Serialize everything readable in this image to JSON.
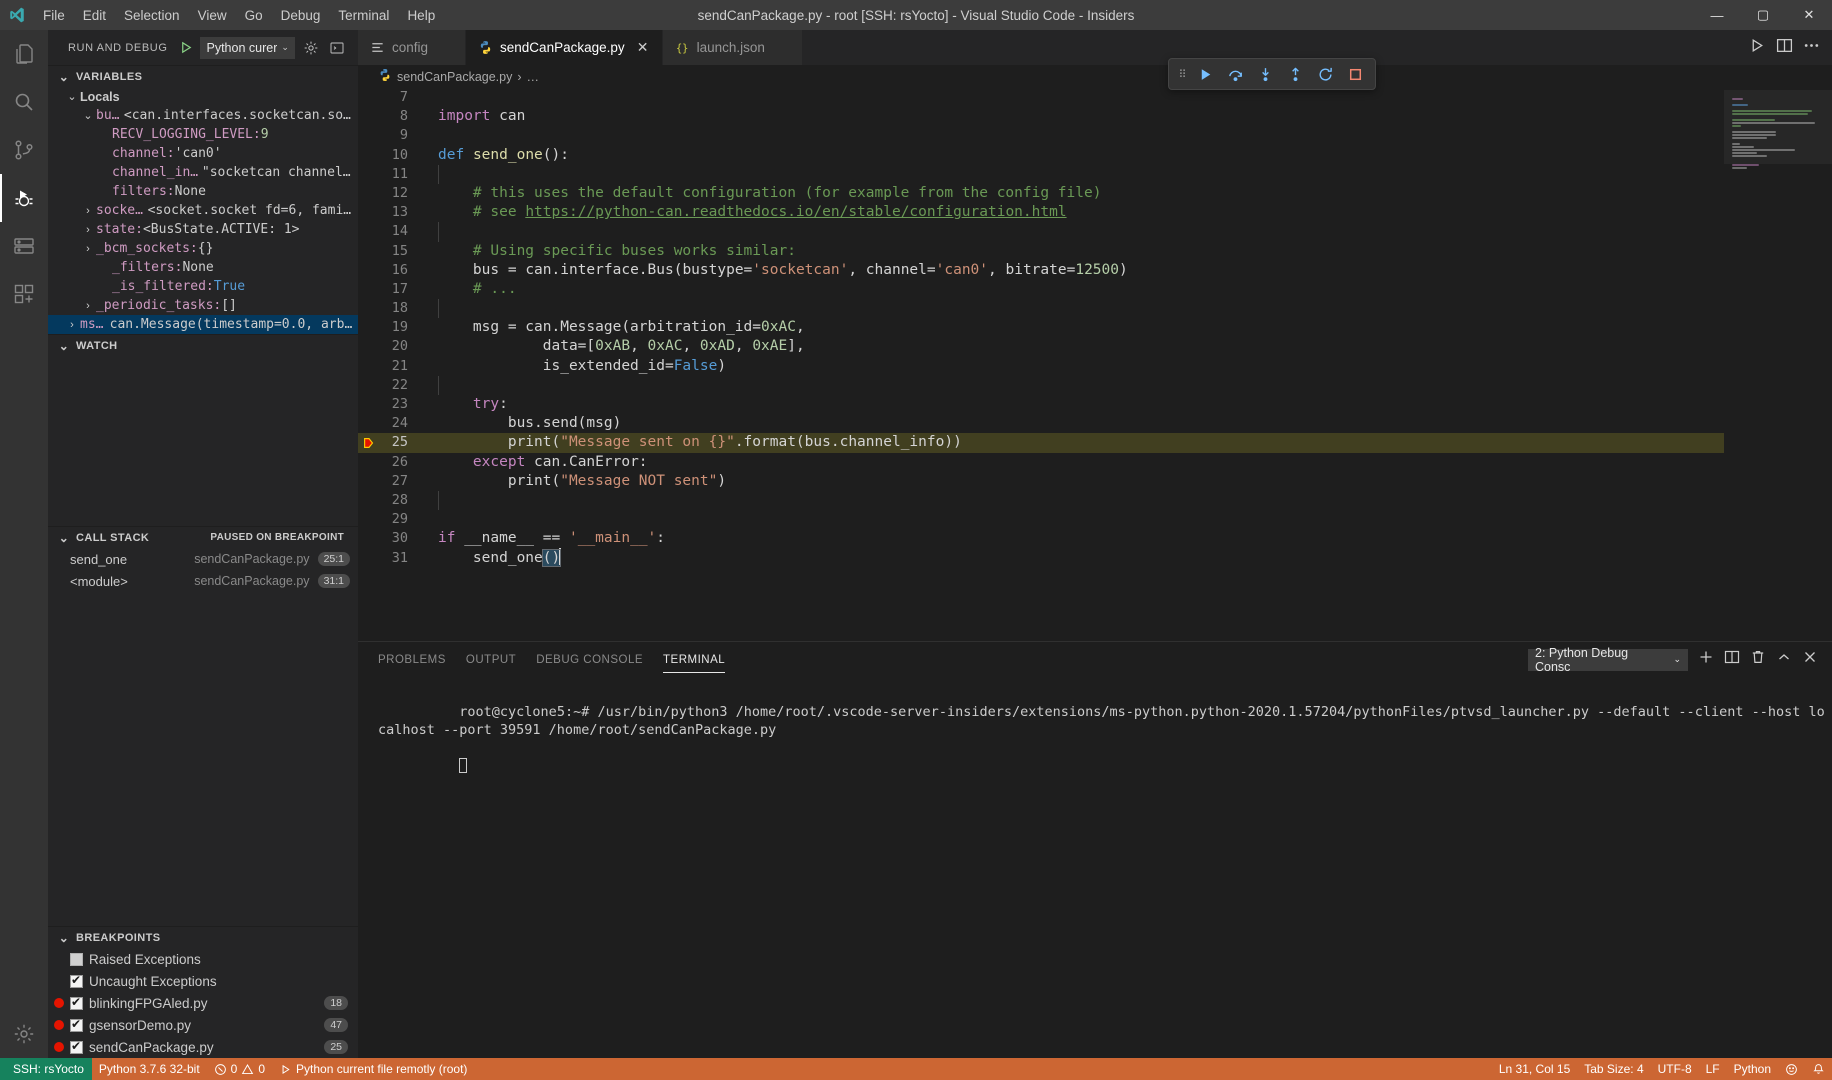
{
  "window": {
    "title": "sendCanPackage.py - root [SSH: rsYocto] - Visual Studio Code - Insiders",
    "minimize": "—",
    "maximize": "▢",
    "close": "✕"
  },
  "menu": [
    "File",
    "Edit",
    "Selection",
    "View",
    "Go",
    "Debug",
    "Terminal",
    "Help"
  ],
  "activitybar": [
    {
      "name": "explorer-icon",
      "label": "Explorer"
    },
    {
      "name": "search-icon",
      "label": "Search"
    },
    {
      "name": "source-control-icon",
      "label": "Source Control"
    },
    {
      "name": "run-and-debug-icon",
      "label": "Run and Debug",
      "badge": ""
    },
    {
      "name": "remote-explorer-icon",
      "label": "Remote Explorer"
    },
    {
      "name": "extensions-icon",
      "label": "Extensions"
    },
    {
      "name": "manage-gear-icon",
      "label": "Manage"
    }
  ],
  "sidebar": {
    "title": "RUN AND DEBUG",
    "config_value": "Python curer",
    "config_chevron": "⌄",
    "gear_icon": "gear-icon",
    "open_debug_console_icon": "open-debug-console-icon",
    "variables": {
      "title": "VARIABLES",
      "scope": "Locals",
      "rows": [
        {
          "twisty": "⌄",
          "indent": 3,
          "name": "bus",
          "sep": ": ",
          "value": "<can.interfaces.socketcan.socket…",
          "kind": "obj"
        },
        {
          "twisty": "",
          "indent": 4,
          "name": "RECV_LOGGING_LEVEL",
          "sep": ": ",
          "value": "9",
          "kind": "num"
        },
        {
          "twisty": "",
          "indent": 4,
          "name": "channel",
          "sep": ": ",
          "value": "'can0'",
          "kind": "obj"
        },
        {
          "twisty": "",
          "indent": 4,
          "name": "channel_info",
          "sep": ": ",
          "value": "\"socketcan channel 'c…",
          "kind": "obj"
        },
        {
          "twisty": "",
          "indent": 4,
          "name": "filters",
          "sep": ": ",
          "value": "None",
          "kind": "obj"
        },
        {
          "twisty": "›",
          "indent": 3,
          "name": "socket",
          "sep": ": ",
          "value": "<socket.socket fd=6, family…",
          "kind": "obj"
        },
        {
          "twisty": "›",
          "indent": 3,
          "name": "state",
          "sep": ": ",
          "value": "<BusState.ACTIVE: 1>",
          "kind": "obj"
        },
        {
          "twisty": "›",
          "indent": 3,
          "name": "_bcm_sockets",
          "sep": ": ",
          "value": "{}",
          "kind": "obj"
        },
        {
          "twisty": "",
          "indent": 4,
          "name": "_filters",
          "sep": ": ",
          "value": "None",
          "kind": "obj"
        },
        {
          "twisty": "",
          "indent": 4,
          "name": "_is_filtered",
          "sep": ": ",
          "value": "True",
          "kind": "bool"
        },
        {
          "twisty": "›",
          "indent": 3,
          "name": "_periodic_tasks",
          "sep": ": ",
          "value": "[]",
          "kind": "obj"
        },
        {
          "twisty": "›",
          "indent": 2,
          "name": "msg",
          "sep": ": ",
          "value": "can.Message(timestamp=0.0, arbit…",
          "kind": "obj",
          "selected": true
        }
      ]
    },
    "watch": {
      "title": "WATCH"
    },
    "callstack": {
      "title": "CALL STACK",
      "status": "PAUSED ON BREAKPOINT",
      "frames": [
        {
          "name": "send_one",
          "file": "sendCanPackage.py",
          "line": "25:1"
        },
        {
          "name": "<module>",
          "file": "sendCanPackage.py",
          "line": "31:1"
        }
      ]
    },
    "breakpoints": {
      "title": "BREAKPOINTS",
      "items": [
        {
          "dot": false,
          "checked": false,
          "label": "Raised Exceptions",
          "line": ""
        },
        {
          "dot": false,
          "checked": true,
          "label": "Uncaught Exceptions",
          "line": ""
        },
        {
          "dot": true,
          "checked": true,
          "label": "blinkingFPGAled.py",
          "line": "18"
        },
        {
          "dot": true,
          "checked": true,
          "label": "gsensorDemo.py",
          "line": "47"
        },
        {
          "dot": true,
          "checked": true,
          "label": "sendCanPackage.py",
          "line": "25"
        }
      ]
    }
  },
  "editor": {
    "tabs": [
      {
        "label": "config",
        "icon": "settings-file-icon",
        "active": false
      },
      {
        "label": "sendCanPackage.py",
        "icon": "python-icon",
        "active": true
      },
      {
        "label": "launch.json",
        "icon": "json-icon",
        "active": false
      }
    ],
    "tab_close": "✕",
    "actions": [
      {
        "name": "run-python-file-button",
        "icon": "play-icon"
      },
      {
        "name": "split-editor-button",
        "icon": "split-icon"
      },
      {
        "name": "more-actions-button",
        "icon": "ellipsis-icon"
      }
    ],
    "breadcrumb": {
      "file": "sendCanPackage.py",
      "sep": "›",
      "rest": "…"
    },
    "lines": [
      {
        "n": "7",
        "tokens": []
      },
      {
        "n": "8",
        "tokens": [
          {
            "t": "import",
            "c": "kp"
          },
          {
            "t": " can",
            "c": "pl"
          }
        ]
      },
      {
        "n": "9",
        "tokens": []
      },
      {
        "n": "10",
        "tokens": [
          {
            "t": "def",
            "c": "k"
          },
          {
            "t": " ",
            "c": "pl"
          },
          {
            "t": "send_one",
            "c": "fn"
          },
          {
            "t": "():",
            "c": "pl"
          }
        ]
      },
      {
        "n": "11",
        "tokens": [],
        "indents": 1
      },
      {
        "n": "12",
        "tokens": [
          {
            "t": "    # this uses the default configuration (for example from the config file)",
            "c": "cmt"
          }
        ],
        "indents": 1
      },
      {
        "n": "13",
        "tokens": [
          {
            "t": "    # see ",
            "c": "cmt"
          },
          {
            "t": "https://python-can.readthedocs.io/en/stable/configuration.html",
            "c": "lnk"
          }
        ],
        "indents": 1
      },
      {
        "n": "14",
        "tokens": [],
        "indents": 1
      },
      {
        "n": "15",
        "tokens": [
          {
            "t": "    # Using specific buses works similar:",
            "c": "cmt"
          }
        ],
        "indents": 1
      },
      {
        "n": "16",
        "tokens": [
          {
            "t": "    bus ",
            "c": "pl"
          },
          {
            "t": "= ",
            "c": "pl"
          },
          {
            "t": "can.interface.Bus(bustype=",
            "c": "pl"
          },
          {
            "t": "'socketcan'",
            "c": "str"
          },
          {
            "t": ", channel=",
            "c": "pl"
          },
          {
            "t": "'can0'",
            "c": "str"
          },
          {
            "t": ", bitrate=",
            "c": "pl"
          },
          {
            "t": "12500",
            "c": "num"
          },
          {
            "t": ")",
            "c": "pl"
          }
        ],
        "indents": 1
      },
      {
        "n": "17",
        "tokens": [
          {
            "t": "    # ...",
            "c": "cmt"
          }
        ],
        "indents": 1
      },
      {
        "n": "18",
        "tokens": [],
        "indents": 1
      },
      {
        "n": "19",
        "tokens": [
          {
            "t": "    msg = can.Message(arbitration_id=",
            "c": "pl"
          },
          {
            "t": "0xAC",
            "c": "num"
          },
          {
            "t": ",",
            "c": "pl"
          }
        ],
        "indents": 1
      },
      {
        "n": "20",
        "tokens": [
          {
            "t": "            data=[",
            "c": "pl"
          },
          {
            "t": "0xAB",
            "c": "num"
          },
          {
            "t": ", ",
            "c": "pl"
          },
          {
            "t": "0xAC",
            "c": "num"
          },
          {
            "t": ", ",
            "c": "pl"
          },
          {
            "t": "0xAD",
            "c": "num"
          },
          {
            "t": ", ",
            "c": "pl"
          },
          {
            "t": "0xAE",
            "c": "num"
          },
          {
            "t": "],",
            "c": "pl"
          }
        ],
        "indents": 2
      },
      {
        "n": "21",
        "tokens": [
          {
            "t": "            is_extended_id=",
            "c": "pl"
          },
          {
            "t": "False",
            "c": "k"
          },
          {
            "t": ")",
            "c": "pl"
          }
        ],
        "indents": 2
      },
      {
        "n": "22",
        "tokens": [],
        "indents": 1
      },
      {
        "n": "23",
        "tokens": [
          {
            "t": "    ",
            "c": "pl"
          },
          {
            "t": "try",
            "c": "kp"
          },
          {
            "t": ":",
            "c": "pl"
          }
        ],
        "indents": 1
      },
      {
        "n": "24",
        "tokens": [
          {
            "t": "        bus.send(msg)",
            "c": "pl"
          }
        ],
        "indents": 2
      },
      {
        "n": "25",
        "tokens": [
          {
            "t": "        print(",
            "c": "pl"
          },
          {
            "t": "\"Message sent on {}\"",
            "c": "str"
          },
          {
            "t": ".format(bus.channel_info))",
            "c": "pl"
          }
        ],
        "indents": 2,
        "highlight": true,
        "marker": "execution-pointer"
      },
      {
        "n": "26",
        "tokens": [
          {
            "t": "    ",
            "c": "pl"
          },
          {
            "t": "except",
            "c": "kp"
          },
          {
            "t": " can.CanError:",
            "c": "pl"
          }
        ],
        "indents": 1
      },
      {
        "n": "27",
        "tokens": [
          {
            "t": "        print(",
            "c": "pl"
          },
          {
            "t": "\"Message NOT sent\"",
            "c": "str"
          },
          {
            "t": ")",
            "c": "pl"
          }
        ],
        "indents": 2
      },
      {
        "n": "28",
        "tokens": [],
        "indents": 1
      },
      {
        "n": "29",
        "tokens": []
      },
      {
        "n": "30",
        "tokens": [
          {
            "t": "if",
            "c": "kp"
          },
          {
            "t": " __name__ ",
            "c": "pl"
          },
          {
            "t": "==",
            "c": "pl"
          },
          {
            "t": " ",
            "c": "pl"
          },
          {
            "t": "'__main__'",
            "c": "str"
          },
          {
            "t": ":",
            "c": "pl"
          }
        ]
      },
      {
        "n": "31",
        "tokens": [
          {
            "t": "    send_one",
            "c": "pl"
          },
          {
            "t": "()",
            "c": "pl",
            "selbrace": true
          }
        ],
        "indents": 1,
        "cursor": true
      }
    ]
  },
  "debug_toolbar": {
    "grip": "⠿",
    "buttons": [
      {
        "name": "continue-button",
        "icon": "play-icon",
        "color": "#75beff"
      },
      {
        "name": "step-over-button",
        "icon": "step-over-icon",
        "color": "#75beff"
      },
      {
        "name": "step-into-button",
        "icon": "step-into-icon",
        "color": "#75beff"
      },
      {
        "name": "step-out-button",
        "icon": "step-out-icon",
        "color": "#75beff"
      },
      {
        "name": "restart-button",
        "icon": "restart-icon",
        "color": "#75beff"
      },
      {
        "name": "stop-button",
        "icon": "stop-icon",
        "color": "#f48771"
      }
    ]
  },
  "panel": {
    "tabs": [
      "PROBLEMS",
      "OUTPUT",
      "DEBUG CONSOLE",
      "TERMINAL"
    ],
    "active_tab": "TERMINAL",
    "terminal_select": "2: Python Debug Consc",
    "terminal_select_chevron": "⌄",
    "actions": [
      {
        "name": "new-terminal-button",
        "icon": "plus-icon"
      },
      {
        "name": "split-terminal-button",
        "icon": "split-icon"
      },
      {
        "name": "kill-terminal-button",
        "icon": "trash-icon"
      },
      {
        "name": "maximize-panel-button",
        "icon": "chevron-up-icon"
      },
      {
        "name": "close-panel-button",
        "icon": "close-icon"
      }
    ],
    "terminal_text": "root@cyclone5:~# /usr/bin/python3 /home/root/.vscode-server-insiders/extensions/ms-python.python-2020.1.57204/pythonFiles/ptvsd_launcher.py --default --client --host localhost --port 39591 /home/root/sendCanPackage.py"
  },
  "statusbar": {
    "remote": "SSH: rsYocto",
    "left": [
      {
        "name": "python-interpreter-status",
        "text": "Python 3.7.6 32-bit"
      },
      {
        "name": "problems-status",
        "text": "0",
        "text2": "0"
      },
      {
        "name": "run-config-status",
        "text": "Python current file remotly (root)"
      }
    ],
    "right": [
      {
        "name": "cursor-position-status",
        "text": "Ln 31, Col 15"
      },
      {
        "name": "tab-size-status",
        "text": "Tab Size: 4"
      },
      {
        "name": "encoding-status",
        "text": "UTF-8"
      },
      {
        "name": "eol-status",
        "text": "LF"
      },
      {
        "name": "language-mode-status",
        "text": "Python"
      },
      {
        "name": "feedback-status",
        "text": ""
      },
      {
        "name": "notifications-status",
        "text": ""
      }
    ]
  },
  "colors": {
    "accent": "#007acc",
    "statusbar_bg": "#cc6633",
    "remote_bg": "#16825d",
    "breakpoint": "#e51400",
    "highlight_line": "#413f20"
  }
}
